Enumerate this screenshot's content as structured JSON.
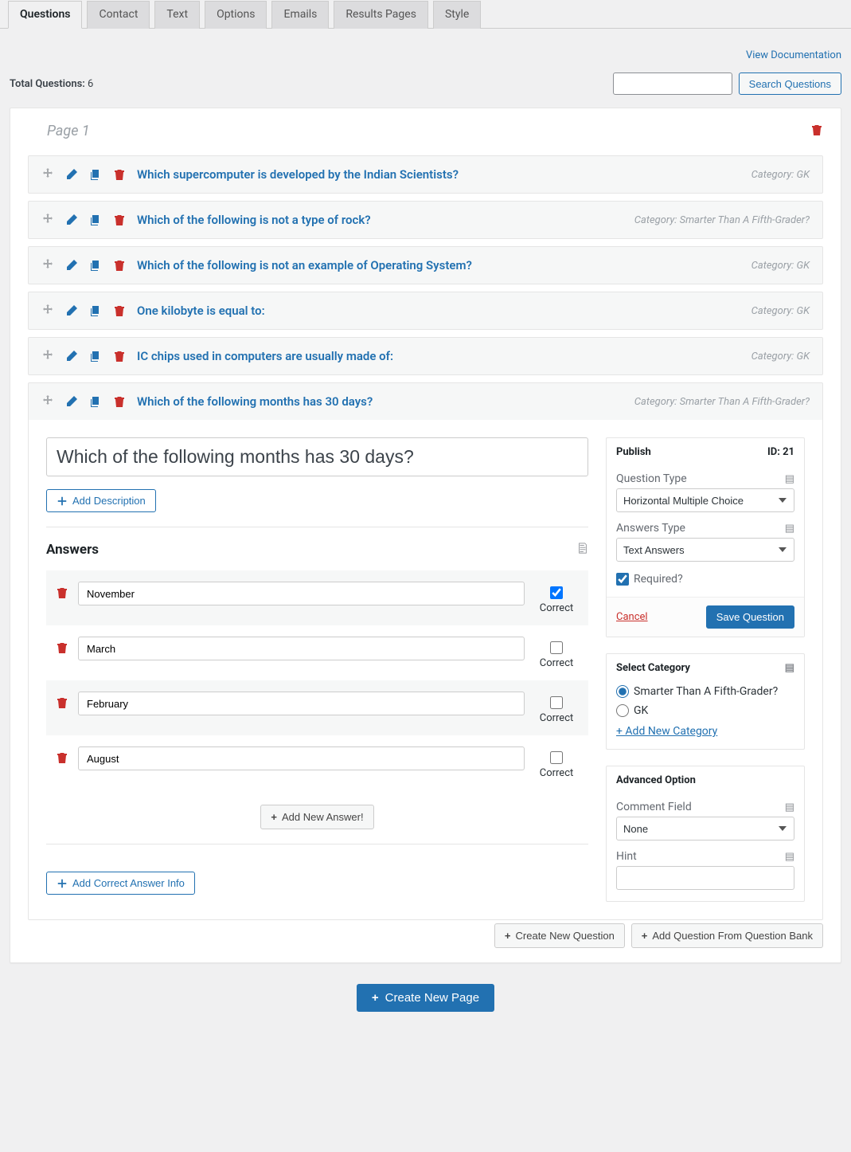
{
  "tabs": [
    "Questions",
    "Contact",
    "Text",
    "Options",
    "Emails",
    "Results Pages",
    "Style"
  ],
  "active_tab": 0,
  "doc_link": "View Documentation",
  "total_label": "Total Questions:",
  "total_value": "6",
  "search_btn": "Search Questions",
  "page_title": "Page 1",
  "category_prefix": "Category:",
  "questions": [
    {
      "title": "Which supercomputer is developed by the Indian Scientists?",
      "category": "GK"
    },
    {
      "title": "Which of the following is not a type of rock?",
      "category": "Smarter Than A Fifth-Grader?"
    },
    {
      "title": "Which of the following is not an example of Operating System?",
      "category": "GK"
    },
    {
      "title": "One kilobyte is equal to:",
      "category": "GK"
    },
    {
      "title": "IC chips used in computers are usually made of:",
      "category": "GK"
    },
    {
      "title": "Which of the following months has 30 days?",
      "category": "Smarter Than A Fifth-Grader?"
    }
  ],
  "editor": {
    "question_text": "Which of the following months has 30 days?",
    "add_description": "Add Description",
    "answers_heading": "Answers",
    "correct_label": "Correct",
    "answers": [
      {
        "text": "November",
        "correct": true
      },
      {
        "text": "March",
        "correct": false
      },
      {
        "text": "February",
        "correct": false
      },
      {
        "text": "August",
        "correct": false
      }
    ],
    "add_answer": "Add New Answer!",
    "add_correct_info": "Add Correct Answer Info"
  },
  "publish": {
    "heading": "Publish",
    "id_label": "ID: 21",
    "question_type_label": "Question Type",
    "question_type_value": "Horizontal Multiple Choice",
    "answers_type_label": "Answers Type",
    "answers_type_value": "Text Answers",
    "required_label": "Required?",
    "required_checked": true,
    "cancel": "Cancel",
    "save": "Save Question"
  },
  "category_panel": {
    "heading": "Select Category",
    "options": [
      "Smarter Than A Fifth-Grader?",
      "GK"
    ],
    "selected_index": 0,
    "add_new": "+ Add New Category"
  },
  "advanced": {
    "heading": "Advanced Option",
    "comment_label": "Comment Field",
    "comment_value": "None",
    "hint_label": "Hint",
    "hint_value": ""
  },
  "footer": {
    "create_question": "Create New Question",
    "add_from_bank": "Add Question From Question Bank",
    "create_page": "Create New Page"
  }
}
